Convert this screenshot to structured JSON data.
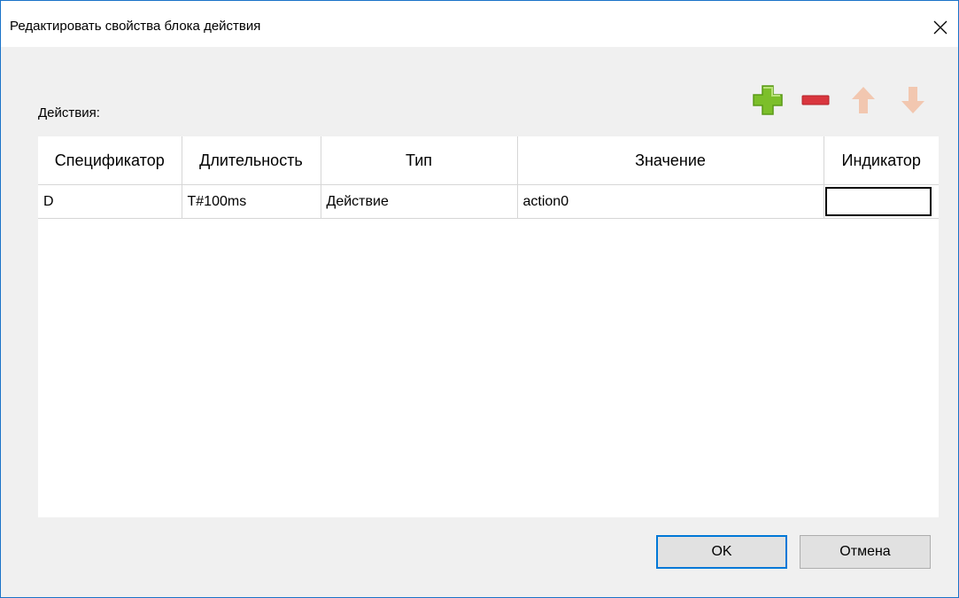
{
  "window": {
    "title": "Редактировать свойства блока действия",
    "close_glyph": "✕"
  },
  "actions_label": "Действия:",
  "toolbar": {
    "add_icon": "plus-icon",
    "remove_icon": "minus-icon",
    "up_icon": "arrow-up-icon",
    "down_icon": "arrow-down-icon",
    "colors": {
      "add": "#7cbf2a",
      "remove": "#d9363e",
      "arrows_disabled": "#f2c7b0"
    }
  },
  "table": {
    "columns": [
      "Спецификатор",
      "Длительность",
      "Тип",
      "Значение",
      "Индикатор"
    ],
    "rows": [
      {
        "qualifier": "D",
        "duration": "T#100ms",
        "type": "Действие",
        "value": "action0",
        "indicator": ""
      }
    ]
  },
  "buttons": {
    "ok": "OK",
    "cancel": "Отмена"
  }
}
